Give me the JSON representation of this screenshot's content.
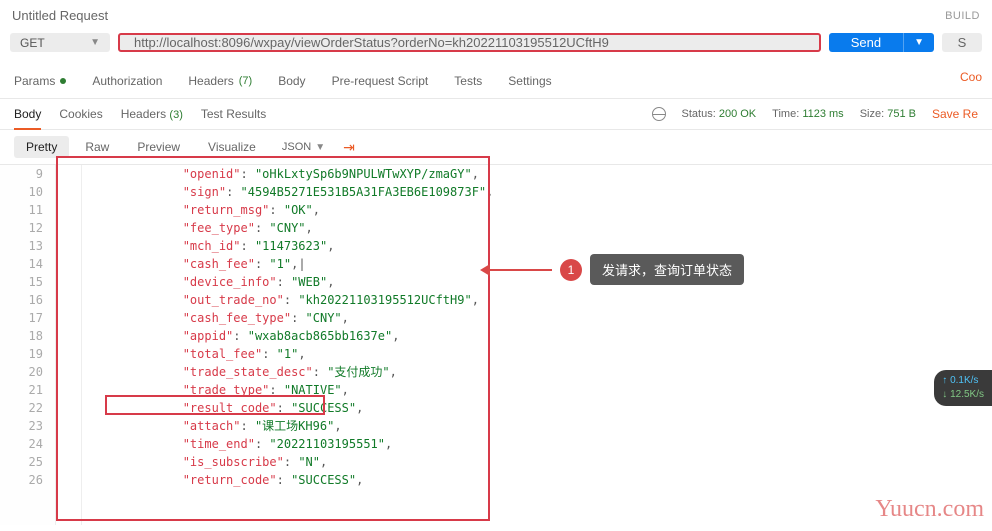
{
  "header": {
    "title": "Untitled Request",
    "build": "BUILD"
  },
  "request": {
    "method": "GET",
    "url": "http://localhost:8096/wxpay/viewOrderStatus?orderNo=kh20221103195512UCftH9",
    "send": "Send",
    "extra": "S"
  },
  "tabs": {
    "params": "Params",
    "auth": "Authorization",
    "headers": "Headers",
    "headers_count": "(7)",
    "body": "Body",
    "prereq": "Pre-request Script",
    "tests": "Tests",
    "settings": "Settings",
    "cookies": "Coo"
  },
  "resp_tabs": {
    "body": "Body",
    "cookies": "Cookies",
    "headers": "Headers",
    "headers_count": "(3)",
    "results": "Test Results"
  },
  "status": {
    "label": "Status:",
    "code": "200 OK",
    "time_label": "Time:",
    "time": "1123 ms",
    "size_label": "Size:",
    "size": "751 B",
    "save": "Save Re"
  },
  "view": {
    "pretty": "Pretty",
    "raw": "Raw",
    "preview": "Preview",
    "visualize": "Visualize",
    "format": "JSON"
  },
  "code_lines": [
    {
      "n": 9,
      "indent": 3,
      "key": "openid",
      "val": "oHkLxtySp6b9NPULWTwXYP/zmaGY",
      "comma": true
    },
    {
      "n": 10,
      "indent": 3,
      "key": "sign",
      "val": "4594B5271E531B5A31FA3EB6E109873F",
      "comma": true
    },
    {
      "n": 11,
      "indent": 3,
      "key": "return_msg",
      "val": "OK",
      "comma": true
    },
    {
      "n": 12,
      "indent": 3,
      "key": "fee_type",
      "val": "CNY",
      "comma": true
    },
    {
      "n": 13,
      "indent": 3,
      "key": "mch_id",
      "val": "11473623",
      "comma": true
    },
    {
      "n": 14,
      "indent": 3,
      "key": "cash_fee",
      "val": "1",
      "comma": true,
      "cursor": true
    },
    {
      "n": 15,
      "indent": 3,
      "key": "device_info",
      "val": "WEB",
      "comma": true
    },
    {
      "n": 16,
      "indent": 3,
      "key": "out_trade_no",
      "val": "kh20221103195512UCftH9",
      "comma": true
    },
    {
      "n": 17,
      "indent": 3,
      "key": "cash_fee_type",
      "val": "CNY",
      "comma": true
    },
    {
      "n": 18,
      "indent": 3,
      "key": "appid",
      "val": "wxab8acb865bb1637e",
      "comma": true
    },
    {
      "n": 19,
      "indent": 3,
      "key": "total_fee",
      "val": "1",
      "comma": true
    },
    {
      "n": 20,
      "indent": 3,
      "key": "trade_state_desc",
      "val": "支付成功",
      "comma": true
    },
    {
      "n": 21,
      "indent": 3,
      "key": "trade_type",
      "val": "NATIVE",
      "comma": true
    },
    {
      "n": 22,
      "indent": 3,
      "key": "result_code",
      "val": "SUCCESS",
      "comma": true
    },
    {
      "n": 23,
      "indent": 3,
      "key": "attach",
      "val": "课工场KH96",
      "comma": true
    },
    {
      "n": 24,
      "indent": 3,
      "key": "time_end",
      "val": "20221103195551",
      "comma": true
    },
    {
      "n": 25,
      "indent": 3,
      "key": "is_subscribe",
      "val": "N",
      "comma": true
    },
    {
      "n": 26,
      "indent": 3,
      "key": "return_code",
      "val": "SUCCESS",
      "comma": true
    }
  ],
  "annotation": {
    "num": "1",
    "text": "发请求，查询订单状态"
  },
  "watermark": "Yuucn.com",
  "net": {
    "up": "↑ 0.1K/s",
    "down": "↓ 12.5K/s"
  }
}
